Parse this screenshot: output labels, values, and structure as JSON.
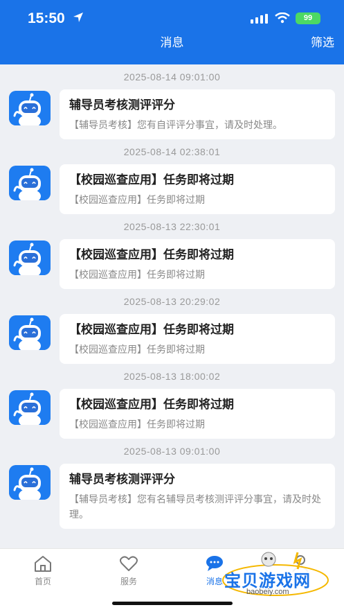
{
  "status_bar": {
    "time": "15:50",
    "battery": "99"
  },
  "nav": {
    "title": "消息",
    "filter": "筛选"
  },
  "messages": [
    {
      "time": "2025-08-14 09:01:00",
      "title": "辅导员考核测评评分",
      "body": "【辅导员考核】您有自评评分事宜，请及时处理。"
    },
    {
      "time": "2025-08-14 02:38:01",
      "title": "【校园巡查应用】任务即将过期",
      "body": "【校园巡查应用】任务即将过期"
    },
    {
      "time": "2025-08-13 22:30:01",
      "title": "【校园巡查应用】任务即将过期",
      "body": "【校园巡查应用】任务即将过期"
    },
    {
      "time": "2025-08-13 20:29:02",
      "title": "【校园巡查应用】任务即将过期",
      "body": "【校园巡查应用】任务即将过期"
    },
    {
      "time": "2025-08-13 18:00:02",
      "title": "【校园巡查应用】任务即将过期",
      "body": "【校园巡查应用】任务即将过期"
    },
    {
      "time": "2025-08-13 09:01:00",
      "title": "辅导员考核测评评分",
      "body": "【辅导员考核】您有名辅导员考核测评评分事宜，请及时处理。"
    }
  ],
  "tabs": [
    {
      "label": "首页",
      "icon": "home-icon",
      "active": false
    },
    {
      "label": "服务",
      "icon": "heart-icon",
      "active": false
    },
    {
      "label": "消息",
      "icon": "message-icon",
      "active": true
    },
    {
      "label": "",
      "icon": "profile-icon",
      "active": false
    }
  ],
  "watermark": {
    "text": "宝贝游戏网",
    "url": "baobeiy.com"
  },
  "colors": {
    "primary": "#1a73e8",
    "background": "#eef0f4",
    "battery": "#4cd964"
  }
}
